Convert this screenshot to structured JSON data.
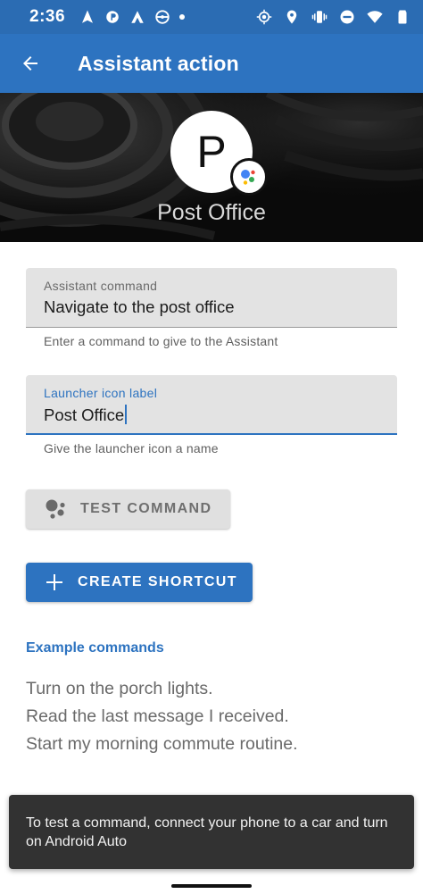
{
  "status_bar": {
    "time": "2:36",
    "left_icons": [
      "navigation-arrow-icon",
      "app-notification-icon",
      "android-auto-icon",
      "steering-wheel-icon",
      "dot-icon"
    ],
    "right_icons": [
      "gps-icon",
      "location-icon",
      "vibrate-icon",
      "do-not-disturb-icon",
      "wifi-icon",
      "battery-icon"
    ]
  },
  "app_bar": {
    "title": "Assistant action",
    "back_icon": "arrow-back-icon"
  },
  "header": {
    "avatar_letter": "P",
    "badge_icon": "google-assistant-icon",
    "name": "Post Office"
  },
  "fields": {
    "command": {
      "label": "Assistant command",
      "value": "Navigate to the post office",
      "helper": "Enter a command to give to the Assistant"
    },
    "launcher": {
      "label": "Launcher icon label",
      "value": "Post Office",
      "helper": "Give the launcher icon a name"
    }
  },
  "buttons": {
    "test_label": "TEST COMMAND",
    "test_icon": "google-assistant-icon",
    "create_label": "CREATE SHORTCUT",
    "create_icon": "plus-icon"
  },
  "examples": {
    "title": "Example commands",
    "items": [
      "Turn on the porch lights.",
      "Read the last message I received.",
      "Start my morning commute routine."
    ]
  },
  "snackbar": {
    "message": "To test a command, connect your phone to a car and turn on Android Auto"
  },
  "colors": {
    "primary": "#2d73c0",
    "status_bar": "#2b6cb3",
    "header_bg": "#0d0d0d",
    "field_bg": "#e3e3e3",
    "snackbar_bg": "#323232"
  }
}
